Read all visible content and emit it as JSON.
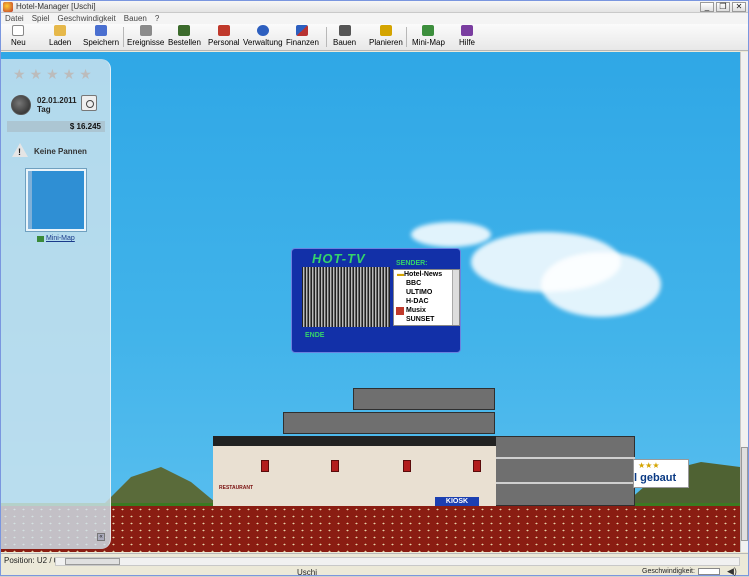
{
  "window": {
    "title": "Hotel-Manager [Uschi]",
    "controls": {
      "minimize": "_",
      "restore": "❐",
      "close": "✕"
    }
  },
  "menu": [
    "Datei",
    "Spiel",
    "Geschwindigkeit",
    "Bauen",
    "?"
  ],
  "toolbar": [
    {
      "label": "Neu",
      "icon": "new-file-icon",
      "color": "#ffffff"
    },
    {
      "label": "Laden",
      "icon": "open-folder-icon",
      "color": "#e6b84a"
    },
    {
      "label": "Speichern",
      "icon": "save-disk-icon",
      "color": "#4a6fd0"
    },
    {
      "label": "Ereignisse",
      "icon": "events-list-icon",
      "color": "#8a8a8a"
    },
    {
      "label": "Bestellen",
      "icon": "truck-icon",
      "color": "#3c6b2c"
    },
    {
      "label": "Personal",
      "icon": "staff-icon",
      "color": "#c0392b"
    },
    {
      "label": "Verwaltung",
      "icon": "info-icon",
      "color": "#2d5fbf"
    },
    {
      "label": "Finanzen",
      "icon": "finance-chart-icon",
      "color": "#b83232"
    },
    {
      "label": "Bauen",
      "icon": "build-crane-icon",
      "color": "#555555"
    },
    {
      "label": "Planieren",
      "icon": "bulldozer-icon",
      "color": "#d4a400"
    },
    {
      "label": "Mini-Map",
      "icon": "mini-map-icon",
      "color": "#3d8f3d"
    },
    {
      "label": "Hilfe",
      "icon": "help-book-icon",
      "color": "#7a3da0"
    }
  ],
  "sidebar": {
    "stars_total": 5,
    "stars_filled": 0,
    "date": "02.01.2011",
    "day_label": "Tag",
    "money": "$ 16.245",
    "warning_text": "Keine Pannen",
    "minimap_link": "Mini-Map"
  },
  "tv_dialog": {
    "logo": "HOT-TV",
    "sender_label": "SENDER:",
    "channels": [
      "Hotel-News",
      "BBC",
      "ULTIMO",
      "H-DAC",
      "Musix",
      "SUNSET"
    ],
    "selected_channel": "Hotel-News",
    "close_label": "ENDE"
  },
  "scene": {
    "sign_stars": "★★★",
    "sign_text": "l gebaut",
    "restaurant_label": "RESTAURANT",
    "kiosk_label": "KIOSK"
  },
  "statusbar": {
    "position": "Position: U2 / 0",
    "user": "Uschi",
    "speed_label": "Geschwindigkeit:"
  }
}
